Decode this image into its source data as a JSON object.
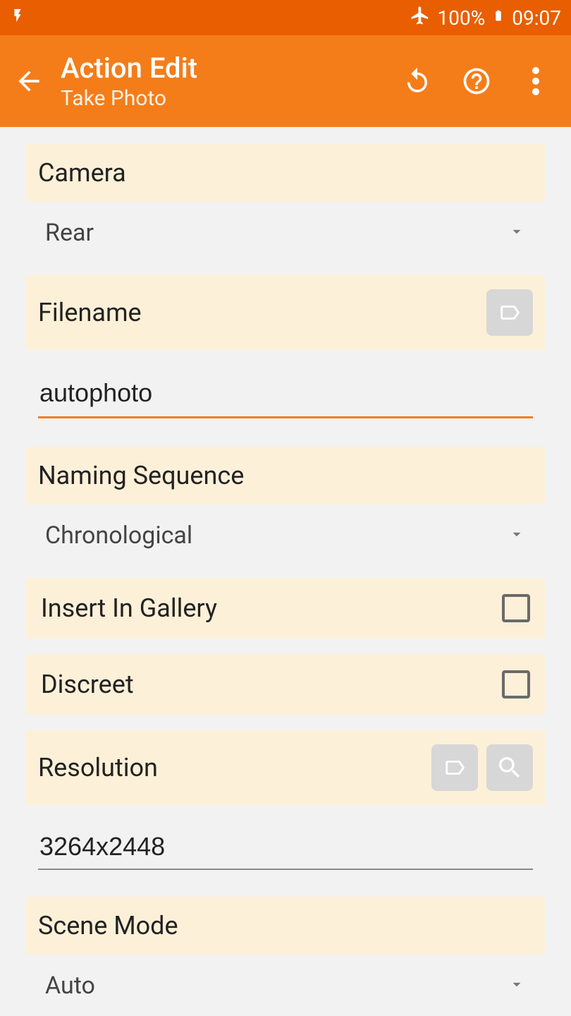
{
  "statusbar": {
    "battery_pct": "100%",
    "time": "09:07"
  },
  "appbar": {
    "title": "Action Edit",
    "subtitle": "Take Photo"
  },
  "sections": {
    "camera": {
      "label": "Camera",
      "value": "Rear"
    },
    "filename": {
      "label": "Filename",
      "value": "autophoto"
    },
    "naming_sequence": {
      "label": "Naming Sequence",
      "value": "Chronological"
    },
    "insert_in_gallery": {
      "label": "Insert In Gallery",
      "checked": false
    },
    "discreet": {
      "label": "Discreet",
      "checked": false
    },
    "resolution": {
      "label": "Resolution",
      "value": "3264x2448"
    },
    "scene_mode": {
      "label": "Scene Mode",
      "value": "Auto"
    }
  }
}
